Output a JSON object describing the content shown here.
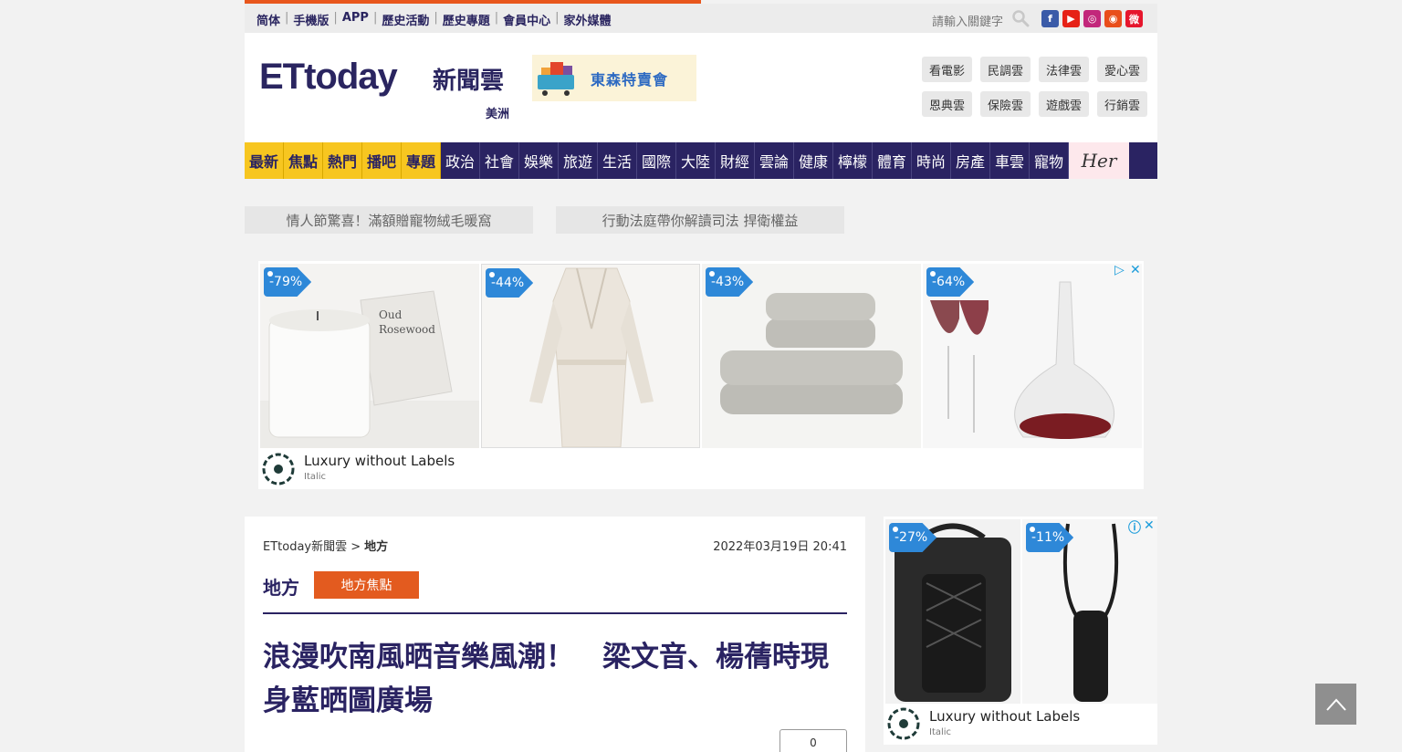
{
  "topbar": {
    "links": [
      "简体",
      "手機版",
      "APP",
      "歷史活動",
      "歷史專題",
      "會員中心",
      "家外媒體"
    ],
    "search_placeholder": "請輸入關鍵字",
    "social": [
      "facebook-icon",
      "youtube-icon",
      "instagram-icon",
      "rss-icon",
      "weibo-icon"
    ]
  },
  "header": {
    "logo_text": "ETtoday",
    "logo_suffix": "新聞雲",
    "region": "美洲",
    "banner_text": "東森特賣會",
    "clouds": [
      "看電影",
      "民調雲",
      "法律雲",
      "愛心雲",
      "恩典雲",
      "保險雲",
      "遊戲雲",
      "行銷雲"
    ]
  },
  "nav": {
    "items": [
      "最新",
      "焦點",
      "熱門",
      "播吧",
      "專題",
      "政治",
      "社會",
      "娛樂",
      "旅遊",
      "生活",
      "國際",
      "大陸",
      "財經",
      "雲論",
      "健康",
      "檸檬",
      "體育",
      "時尚",
      "房產",
      "車雲",
      "寵物"
    ],
    "her_label": "Her"
  },
  "promos": [
    "情人節驚喜！滿額贈寵物絨毛暖窩",
    "行動法庭帶你解讀司法 捍衛權益"
  ],
  "big_ad": {
    "discounts": [
      "-79%",
      "-44%",
      "-43%",
      "-64%"
    ],
    "candle_text": "Oud Rosewood",
    "brand": "Luxury without Labels",
    "advertiser": "Italic"
  },
  "article": {
    "breadcrumb_root": "ETtoday新聞雲 >",
    "breadcrumb_current": "地方",
    "date": "2022年03月19日 20:41",
    "section": "地方",
    "section_button": "地方焦點",
    "headline": "浪漫吹南風晒音樂風潮！　梁文音、楊蒨時現身藍晒圖廣場",
    "counter": "0"
  },
  "side_ad": {
    "discounts": [
      "-27%",
      "-11%"
    ],
    "brand": "Luxury without Labels",
    "advertiser": "Italic"
  },
  "colors": {
    "navy": "#2a2362",
    "yellow": "#f7c620",
    "orange": "#e35b1f",
    "tag_blue": "#2e88d8"
  }
}
